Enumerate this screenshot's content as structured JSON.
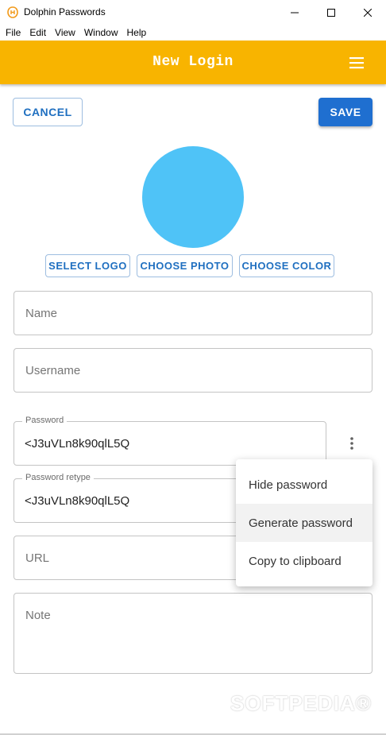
{
  "window": {
    "title": "Dolphin Passwords"
  },
  "menubar": {
    "items": [
      "File",
      "Edit",
      "View",
      "Window",
      "Help"
    ]
  },
  "appbar": {
    "title": "New Login",
    "color": "#f8b400"
  },
  "actions": {
    "cancel_label": "CANCEL",
    "save_label": "SAVE"
  },
  "avatar": {
    "color": "#4fc3f7"
  },
  "logo_buttons": {
    "select_logo": "SELECT LOGO",
    "choose_photo": "CHOOSE PHOTO",
    "choose_color": "CHOOSE COLOR"
  },
  "form": {
    "name": {
      "placeholder": "Name",
      "value": ""
    },
    "username": {
      "placeholder": "Username",
      "value": ""
    },
    "password": {
      "label": "Password",
      "value": "<J3uVLn8k90qlL5Q"
    },
    "password_retype": {
      "label": "Password retype",
      "value": "<J3uVLn8k90qlL5Q"
    },
    "url": {
      "placeholder": "URL",
      "value": ""
    },
    "note": {
      "placeholder": "Note",
      "value": ""
    }
  },
  "password_menu": {
    "items": [
      "Hide password",
      "Generate password",
      "Copy to clipboard"
    ]
  },
  "watermark": "SOFTPEDIA®",
  "icons": {
    "app": "dolphin-icon",
    "menu": "hamburger-menu-icon",
    "more": "more-vertical-icon"
  }
}
